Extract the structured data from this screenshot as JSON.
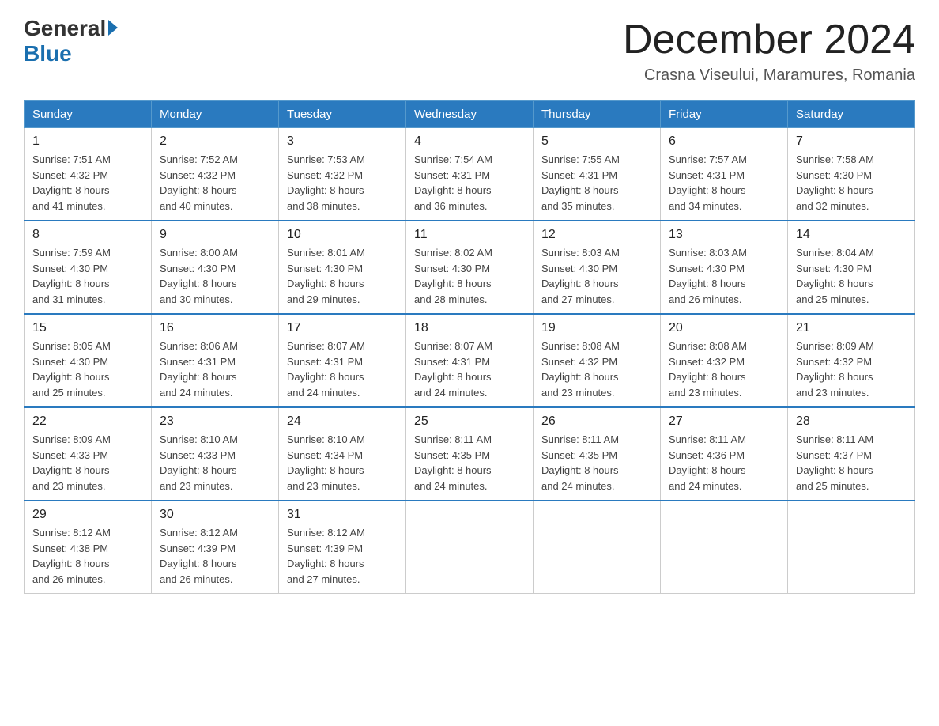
{
  "header": {
    "logo": {
      "general": "General",
      "blue": "Blue"
    },
    "title": "December 2024",
    "location": "Crasna Viseului, Maramures, Romania"
  },
  "days_of_week": [
    "Sunday",
    "Monday",
    "Tuesday",
    "Wednesday",
    "Thursday",
    "Friday",
    "Saturday"
  ],
  "weeks": [
    [
      {
        "day": "1",
        "sunrise": "7:51 AM",
        "sunset": "4:32 PM",
        "daylight": "8 hours and 41 minutes."
      },
      {
        "day": "2",
        "sunrise": "7:52 AM",
        "sunset": "4:32 PM",
        "daylight": "8 hours and 40 minutes."
      },
      {
        "day": "3",
        "sunrise": "7:53 AM",
        "sunset": "4:32 PM",
        "daylight": "8 hours and 38 minutes."
      },
      {
        "day": "4",
        "sunrise": "7:54 AM",
        "sunset": "4:31 PM",
        "daylight": "8 hours and 36 minutes."
      },
      {
        "day": "5",
        "sunrise": "7:55 AM",
        "sunset": "4:31 PM",
        "daylight": "8 hours and 35 minutes."
      },
      {
        "day": "6",
        "sunrise": "7:57 AM",
        "sunset": "4:31 PM",
        "daylight": "8 hours and 34 minutes."
      },
      {
        "day": "7",
        "sunrise": "7:58 AM",
        "sunset": "4:30 PM",
        "daylight": "8 hours and 32 minutes."
      }
    ],
    [
      {
        "day": "8",
        "sunrise": "7:59 AM",
        "sunset": "4:30 PM",
        "daylight": "8 hours and 31 minutes."
      },
      {
        "day": "9",
        "sunrise": "8:00 AM",
        "sunset": "4:30 PM",
        "daylight": "8 hours and 30 minutes."
      },
      {
        "day": "10",
        "sunrise": "8:01 AM",
        "sunset": "4:30 PM",
        "daylight": "8 hours and 29 minutes."
      },
      {
        "day": "11",
        "sunrise": "8:02 AM",
        "sunset": "4:30 PM",
        "daylight": "8 hours and 28 minutes."
      },
      {
        "day": "12",
        "sunrise": "8:03 AM",
        "sunset": "4:30 PM",
        "daylight": "8 hours and 27 minutes."
      },
      {
        "day": "13",
        "sunrise": "8:03 AM",
        "sunset": "4:30 PM",
        "daylight": "8 hours and 26 minutes."
      },
      {
        "day": "14",
        "sunrise": "8:04 AM",
        "sunset": "4:30 PM",
        "daylight": "8 hours and 25 minutes."
      }
    ],
    [
      {
        "day": "15",
        "sunrise": "8:05 AM",
        "sunset": "4:30 PM",
        "daylight": "8 hours and 25 minutes."
      },
      {
        "day": "16",
        "sunrise": "8:06 AM",
        "sunset": "4:31 PM",
        "daylight": "8 hours and 24 minutes."
      },
      {
        "day": "17",
        "sunrise": "8:07 AM",
        "sunset": "4:31 PM",
        "daylight": "8 hours and 24 minutes."
      },
      {
        "day": "18",
        "sunrise": "8:07 AM",
        "sunset": "4:31 PM",
        "daylight": "8 hours and 24 minutes."
      },
      {
        "day": "19",
        "sunrise": "8:08 AM",
        "sunset": "4:32 PM",
        "daylight": "8 hours and 23 minutes."
      },
      {
        "day": "20",
        "sunrise": "8:08 AM",
        "sunset": "4:32 PM",
        "daylight": "8 hours and 23 minutes."
      },
      {
        "day": "21",
        "sunrise": "8:09 AM",
        "sunset": "4:32 PM",
        "daylight": "8 hours and 23 minutes."
      }
    ],
    [
      {
        "day": "22",
        "sunrise": "8:09 AM",
        "sunset": "4:33 PM",
        "daylight": "8 hours and 23 minutes."
      },
      {
        "day": "23",
        "sunrise": "8:10 AM",
        "sunset": "4:33 PM",
        "daylight": "8 hours and 23 minutes."
      },
      {
        "day": "24",
        "sunrise": "8:10 AM",
        "sunset": "4:34 PM",
        "daylight": "8 hours and 23 minutes."
      },
      {
        "day": "25",
        "sunrise": "8:11 AM",
        "sunset": "4:35 PM",
        "daylight": "8 hours and 24 minutes."
      },
      {
        "day": "26",
        "sunrise": "8:11 AM",
        "sunset": "4:35 PM",
        "daylight": "8 hours and 24 minutes."
      },
      {
        "day": "27",
        "sunrise": "8:11 AM",
        "sunset": "4:36 PM",
        "daylight": "8 hours and 24 minutes."
      },
      {
        "day": "28",
        "sunrise": "8:11 AM",
        "sunset": "4:37 PM",
        "daylight": "8 hours and 25 minutes."
      }
    ],
    [
      {
        "day": "29",
        "sunrise": "8:12 AM",
        "sunset": "4:38 PM",
        "daylight": "8 hours and 26 minutes."
      },
      {
        "day": "30",
        "sunrise": "8:12 AM",
        "sunset": "4:39 PM",
        "daylight": "8 hours and 26 minutes."
      },
      {
        "day": "31",
        "sunrise": "8:12 AM",
        "sunset": "4:39 PM",
        "daylight": "8 hours and 27 minutes."
      },
      null,
      null,
      null,
      null
    ]
  ],
  "labels": {
    "sunrise": "Sunrise:",
    "sunset": "Sunset:",
    "daylight": "Daylight:"
  }
}
